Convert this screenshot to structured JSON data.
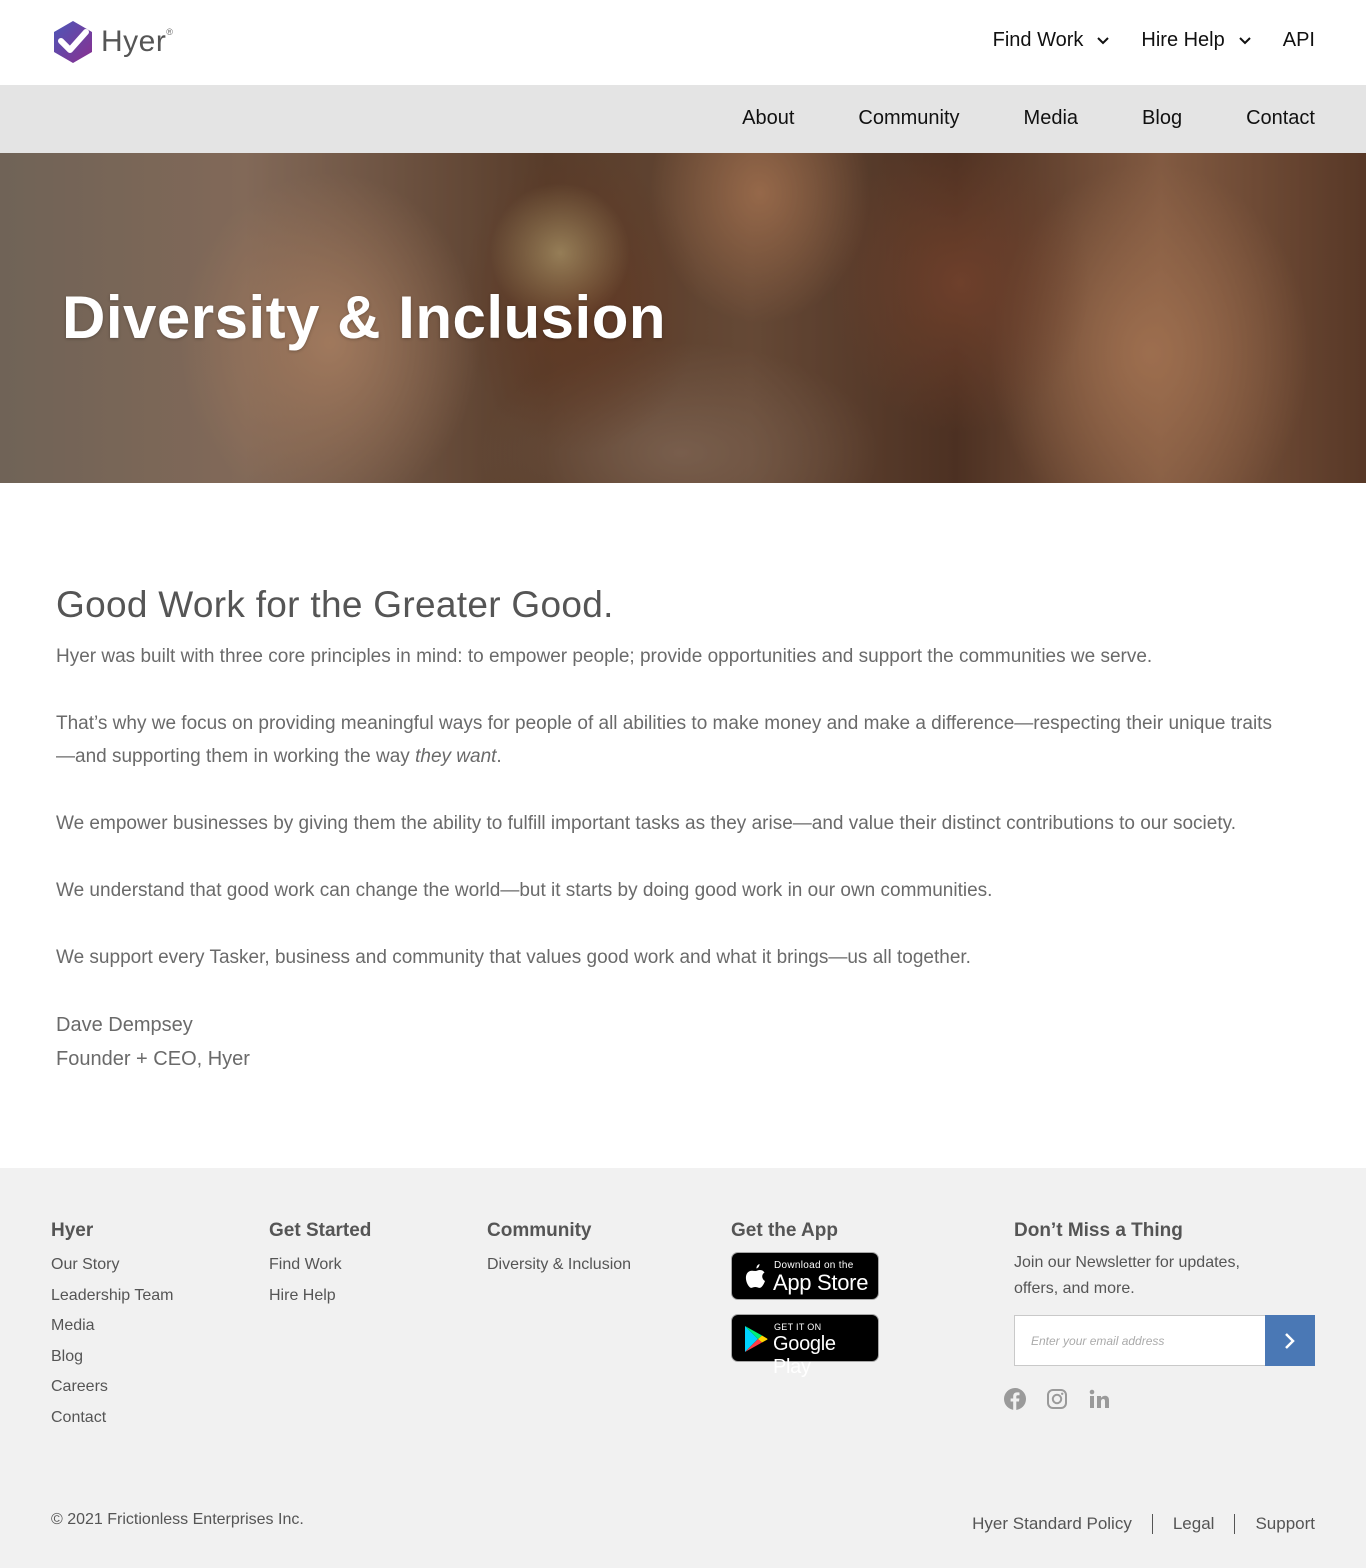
{
  "brand": {
    "name": "Hyer",
    "reg": "®"
  },
  "topnav": {
    "find_work": "Find Work",
    "hire_help": "Hire Help",
    "api": "API"
  },
  "subnav": [
    "About",
    "Community",
    "Media",
    "Blog",
    "Contact"
  ],
  "hero": {
    "title": "Diversity & Inclusion"
  },
  "content": {
    "heading": "Good Work for the Greater Good.",
    "p1": "Hyer was built with three core principles in mind: to empower people; provide opportunities and support the communities we serve.",
    "p2_start": "That’s why we focus on providing meaningful ways for people of all abilities to make money and make a difference—respecting their unique traits—and supporting them in working the way ",
    "p2_em": "they want",
    "p2_end": ".",
    "p3": "We empower businesses by giving them the ability to fulfill important tasks as they arise—and value their distinct contributions to our society.",
    "p4": "We understand that good work can change the world—but it starts by doing good work in our own communities.",
    "p5": "We support every Tasker, business and community that values good work and what it brings—us all together.",
    "sig_name": "Dave Dempsey",
    "sig_title": "Founder + CEO, Hyer"
  },
  "footer": {
    "col_hyer": {
      "title": "Hyer",
      "links": [
        "Our Story",
        "Leadership Team",
        "Media",
        "Blog",
        "Careers",
        "Contact"
      ]
    },
    "col_started": {
      "title": "Get Started",
      "links": [
        "Find Work",
        "Hire Help"
      ]
    },
    "col_community": {
      "title": "Community",
      "links": [
        "Diversity & Inclusion"
      ]
    },
    "col_app": {
      "title": "Get the App",
      "appstore_small": "Download on the",
      "appstore_big": "App Store",
      "play_small": "GET IT ON",
      "play_big": "Google Play"
    },
    "col_news": {
      "title": "Don’t Miss a Thing",
      "text": "Join our Newsletter for updates, offers, and more.",
      "email_placeholder": "Enter your email address"
    },
    "social_icons": [
      "facebook-icon",
      "instagram-icon",
      "linkedin-icon"
    ],
    "copyright": "© 2021 Frictionless Enterprises Inc.",
    "legal": [
      "Hyer Standard Policy",
      "Legal",
      "Support"
    ]
  },
  "colors": {
    "accent": "#4a78b5",
    "subnav_bg": "#e4e4e4",
    "footer_bg": "#f1f1f1",
    "logo_purple": "#6b3fa0"
  }
}
